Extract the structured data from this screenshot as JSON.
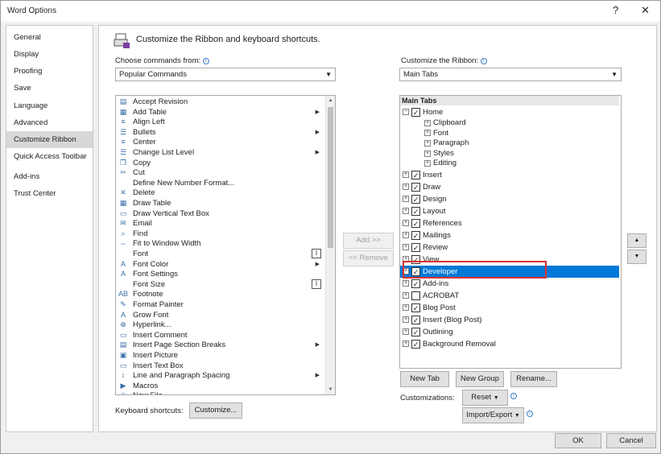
{
  "window": {
    "title": "Word Options",
    "help_label": "?",
    "close_label": "✕"
  },
  "sidebar": {
    "items": [
      {
        "label": "General"
      },
      {
        "label": "Display"
      },
      {
        "label": "Proofing"
      },
      {
        "label": "Save"
      },
      {
        "label": "Language"
      },
      {
        "label": "Advanced"
      },
      {
        "label": "Customize Ribbon",
        "selected": true
      },
      {
        "label": "Quick Access Toolbar"
      },
      {
        "label": "Add-ins"
      },
      {
        "label": "Trust Center"
      }
    ]
  },
  "main": {
    "headline": "Customize the Ribbon and keyboard shortcuts.",
    "choose_label": "Choose commands from:",
    "choose_value": "Popular Commands",
    "customize_label": "Customize the Ribbon:",
    "customize_value": "Main Tabs",
    "commands": [
      {
        "label": "Accept Revision",
        "icon": "accept-revision-icon",
        "glyph": "▤"
      },
      {
        "label": "Add Table",
        "icon": "table-icon",
        "glyph": "▦",
        "submenu": true
      },
      {
        "label": "Align Left",
        "icon": "align-left-icon",
        "glyph": "≡"
      },
      {
        "label": "Bullets",
        "icon": "bullets-icon",
        "glyph": "☰",
        "submenu": true
      },
      {
        "label": "Center",
        "icon": "center-icon",
        "glyph": "≡"
      },
      {
        "label": "Change List Level",
        "icon": "list-level-icon",
        "glyph": "☰",
        "submenu": true
      },
      {
        "label": "Copy",
        "icon": "copy-icon",
        "glyph": "❐"
      },
      {
        "label": "Cut",
        "icon": "cut-icon",
        "glyph": "✂"
      },
      {
        "label": "Define New Number Format...",
        "icon": "",
        "glyph": ""
      },
      {
        "label": "Delete",
        "icon": "delete-icon",
        "glyph": "✕"
      },
      {
        "label": "Draw Table",
        "icon": "draw-table-icon",
        "glyph": "▦"
      },
      {
        "label": "Draw Vertical Text Box",
        "icon": "text-box-icon",
        "glyph": "▭"
      },
      {
        "label": "Email",
        "icon": "email-icon",
        "glyph": "✉"
      },
      {
        "label": "Find",
        "icon": "find-icon",
        "glyph": "⌕"
      },
      {
        "label": "Fit to Window Width",
        "icon": "fit-width-icon",
        "glyph": "⇔"
      },
      {
        "label": "Font",
        "icon": "",
        "glyph": "",
        "box": "I"
      },
      {
        "label": "Font Color",
        "icon": "font-color-icon",
        "glyph": "A",
        "submenu": true
      },
      {
        "label": "Font Settings",
        "icon": "font-settings-icon",
        "glyph": "A"
      },
      {
        "label": "Font Size",
        "icon": "",
        "glyph": "",
        "box": "I"
      },
      {
        "label": "Footnote",
        "icon": "footnote-icon",
        "glyph": "AB"
      },
      {
        "label": "Format Painter",
        "icon": "format-painter-icon",
        "glyph": "✎"
      },
      {
        "label": "Grow Font",
        "icon": "grow-font-icon",
        "glyph": "A"
      },
      {
        "label": "Hyperlink...",
        "icon": "hyperlink-icon",
        "glyph": "⊕"
      },
      {
        "label": "Insert Comment",
        "icon": "comment-icon",
        "glyph": "▭"
      },
      {
        "label": "Insert Page  Section Breaks",
        "icon": "page-break-icon",
        "glyph": "▤",
        "submenu": true
      },
      {
        "label": "Insert Picture",
        "icon": "picture-icon",
        "glyph": "▣"
      },
      {
        "label": "Insert Text Box",
        "icon": "text-box-icon",
        "glyph": "▭"
      },
      {
        "label": "Line and Paragraph Spacing",
        "icon": "spacing-icon",
        "glyph": "↕",
        "submenu": true
      },
      {
        "label": "Macros",
        "icon": "macros-icon",
        "glyph": "▶"
      },
      {
        "label": "New File",
        "icon": "new-file-icon",
        "glyph": "▯"
      }
    ],
    "add_button": "Add >>",
    "remove_button": "<< Remove",
    "tree_header": "Main Tabs",
    "tree": [
      {
        "label": "Home",
        "level": 0,
        "checked": true,
        "expanded": true
      },
      {
        "label": "Clipboard",
        "level": 1
      },
      {
        "label": "Font",
        "level": 1
      },
      {
        "label": "Paragraph",
        "level": 1
      },
      {
        "label": "Styles",
        "level": 1
      },
      {
        "label": "Editing",
        "level": 1
      },
      {
        "label": "Insert",
        "level": 0,
        "checked": true
      },
      {
        "label": "Draw",
        "level": 0,
        "checked": true
      },
      {
        "label": "Design",
        "level": 0,
        "checked": true
      },
      {
        "label": "Layout",
        "level": 0,
        "checked": true
      },
      {
        "label": "References",
        "level": 0,
        "checked": true
      },
      {
        "label": "Mailings",
        "level": 0,
        "checked": true
      },
      {
        "label": "Review",
        "level": 0,
        "checked": true
      },
      {
        "label": "View",
        "level": 0,
        "checked": true
      },
      {
        "label": "Developer",
        "level": 0,
        "checked": true,
        "selected": true
      },
      {
        "label": "Add-ins",
        "level": 0,
        "checked": true
      },
      {
        "label": "ACROBAT",
        "level": 0,
        "checked": false
      },
      {
        "label": "Blog Post",
        "level": 0,
        "checked": true
      },
      {
        "label": "Insert (Blog Post)",
        "level": 0,
        "checked": true
      },
      {
        "label": "Outlining",
        "level": 0,
        "checked": true
      },
      {
        "label": "Background Removal",
        "level": 0,
        "checked": true
      }
    ],
    "new_tab_button": "New Tab",
    "new_group_button": "New Group",
    "rename_button": "Rename...",
    "customizations_label": "Customizations:",
    "reset_button": "Reset",
    "import_export_button": "Import/Export",
    "keyboard_label": "Keyboard shortcuts:",
    "customize_button": "Customize...",
    "move_up_label": "▲",
    "move_down_label": "▼"
  },
  "footer": {
    "ok_button": "OK",
    "cancel_button": "Cancel"
  },
  "colors": {
    "selection": "#0078d7",
    "highlight_border": "#e03030"
  }
}
